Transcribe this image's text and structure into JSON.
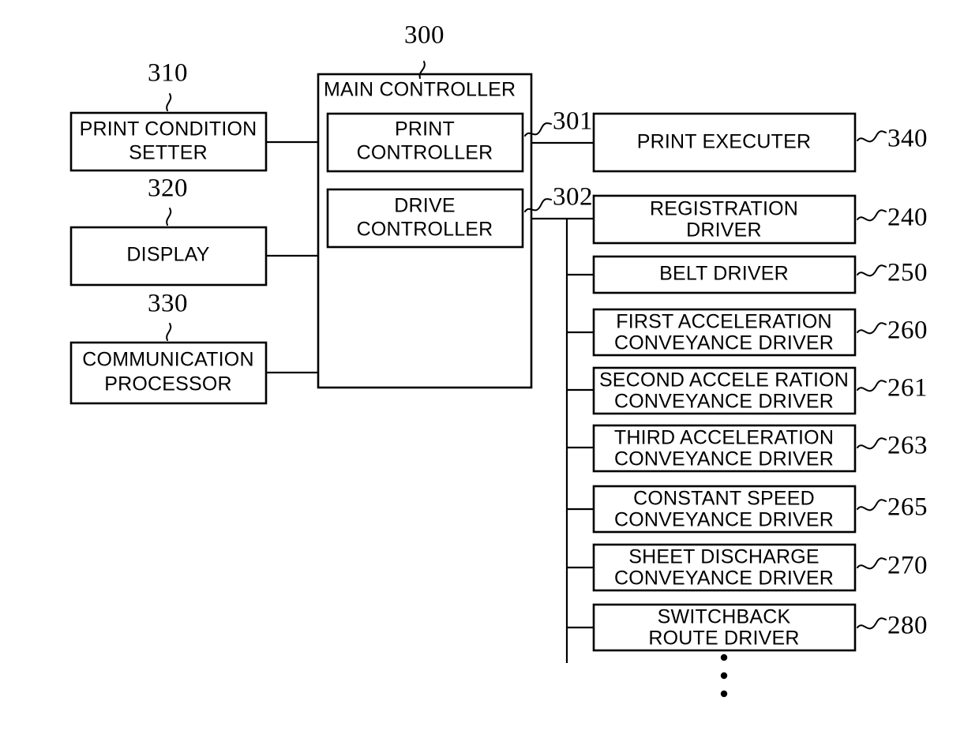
{
  "figure": {
    "kind": "patent-block-diagram",
    "background_color": "#ffffff",
    "line_color": "#000000"
  },
  "main_controller": {
    "title": "MAIN CONTROLLER",
    "ref": "300",
    "children": [
      {
        "label_line1": "PRINT",
        "label_line2": "CONTROLLER",
        "ref": "301"
      },
      {
        "label_line1": "DRIVE",
        "label_line2": "CONTROLLER",
        "ref": "302"
      }
    ]
  },
  "left_column": {
    "items": [
      {
        "label_line1": "PRINT CONDITION",
        "label_line2": "SETTER",
        "ref": "310"
      },
      {
        "label_line1": "DISPLAY",
        "label_line2": "",
        "ref": "320"
      },
      {
        "label_line1": "COMMUNICATION",
        "label_line2": "PROCESSOR",
        "ref": "330"
      }
    ]
  },
  "print_branch": {
    "items": [
      {
        "label_line1": "PRINT EXECUTER",
        "label_line2": "",
        "ref": "340"
      }
    ]
  },
  "drive_branch": {
    "items": [
      {
        "label_line1": "REGISTRATION",
        "label_line2": "DRIVER",
        "ref": "240"
      },
      {
        "label_line1": "BELT DRIVER",
        "label_line2": "",
        "ref": "250"
      },
      {
        "label_line1": "FIRST ACCELERATION",
        "label_line2": "CONVEYANCE DRIVER",
        "ref": "260"
      },
      {
        "label_line1": "SECOND ACCELE RATION",
        "label_line2": "CONVEYANCE DRIVER",
        "ref": "261"
      },
      {
        "label_line1": "THIRD ACCELERATION",
        "label_line2": "CONVEYANCE DRIVER",
        "ref": "263"
      },
      {
        "label_line1": "CONSTANT SPEED",
        "label_line2": "CONVEYANCE DRIVER",
        "ref": "265"
      },
      {
        "label_line1": "SHEET DISCHARGE",
        "label_line2": "CONVEYANCE DRIVER",
        "ref": "270"
      },
      {
        "label_line1": "SWITCHBACK",
        "label_line2": "ROUTE DRIVER",
        "ref": "280"
      }
    ],
    "continuation_marker": "vertical-ellipsis"
  }
}
